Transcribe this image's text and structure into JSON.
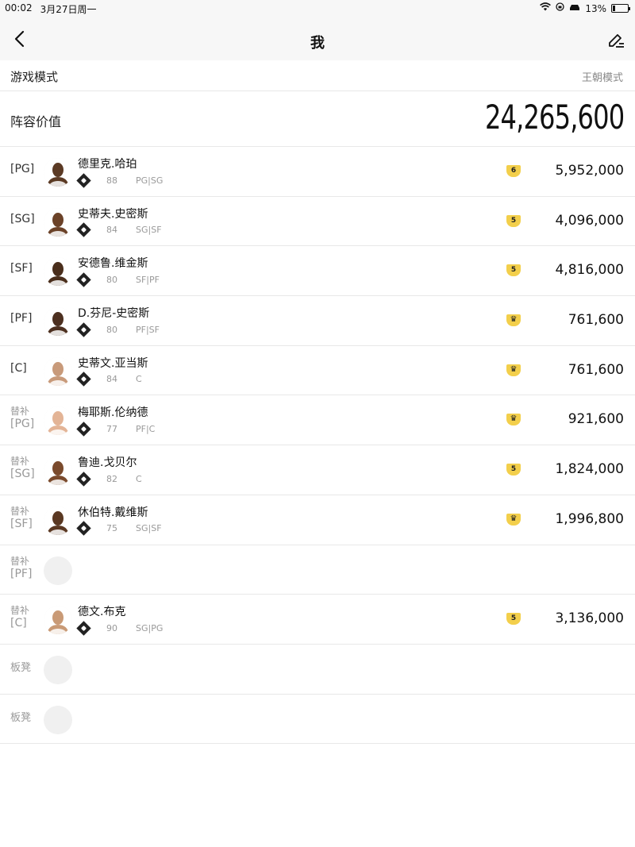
{
  "status_bar": {
    "time": "00:02",
    "date": "3月27日周一",
    "battery": "13%",
    "battery_level": 0.13
  },
  "nav": {
    "title": "我",
    "back_icon": "chevron-left-icon",
    "edit_icon": "edit-icon"
  },
  "game_mode": {
    "label": "游戏模式",
    "value": "王朝模式"
  },
  "lineup_value": {
    "label": "阵容价值",
    "value": "24,265,600"
  },
  "players": [
    {
      "slot": "[PG]",
      "sub_tag": "",
      "name": "德里克.哈珀",
      "ovr": "88",
      "positions": "PG|SG",
      "tier": "6",
      "tier_type": "number",
      "price": "5,952,000",
      "skin": "#5b3a24"
    },
    {
      "slot": "[SG]",
      "sub_tag": "",
      "name": "史蒂夫.史密斯",
      "ovr": "84",
      "positions": "SG|SF",
      "tier": "5",
      "tier_type": "number",
      "price": "4,096,000",
      "skin": "#6b4228"
    },
    {
      "slot": "[SF]",
      "sub_tag": "",
      "name": "安德鲁.维金斯",
      "ovr": "80",
      "positions": "SF|PF",
      "tier": "5",
      "tier_type": "number",
      "price": "4,816,000",
      "skin": "#4a2e1c"
    },
    {
      "slot": "[PF]",
      "sub_tag": "",
      "name": "D.芬尼-史密斯",
      "ovr": "80",
      "positions": "PF|SF",
      "tier": "♛",
      "tier_type": "crown",
      "price": "761,600",
      "skin": "#4d3020"
    },
    {
      "slot": "[C]",
      "sub_tag": "",
      "name": "史蒂文.亚当斯",
      "ovr": "84",
      "positions": "C",
      "tier": "♛",
      "tier_type": "crown",
      "price": "761,600",
      "skin": "#c89a7a"
    },
    {
      "slot": "[PG]",
      "sub_tag": "替补",
      "name": "梅耶斯.伦纳德",
      "ovr": "77",
      "positions": "PF|C",
      "tier": "♛",
      "tier_type": "crown",
      "price": "921,600",
      "skin": "#e3b496"
    },
    {
      "slot": "[SG]",
      "sub_tag": "替补",
      "name": "鲁迪.戈贝尔",
      "ovr": "82",
      "positions": "C",
      "tier": "5",
      "tier_type": "number",
      "price": "1,824,000",
      "skin": "#7a4a2c"
    },
    {
      "slot": "[SF]",
      "sub_tag": "替补",
      "name": "休伯特.戴维斯",
      "ovr": "75",
      "positions": "SG|SF",
      "tier": "♛",
      "tier_type": "crown",
      "price": "1,996,800",
      "skin": "#5a3822"
    },
    {
      "slot": "[PF]",
      "sub_tag": "替补",
      "name": "",
      "ovr": "",
      "positions": "",
      "tier": "",
      "tier_type": "empty",
      "price": "",
      "skin": ""
    },
    {
      "slot": "[C]",
      "sub_tag": "替补",
      "name": "德文.布克",
      "ovr": "90",
      "positions": "SG|PG",
      "tier": "5",
      "tier_type": "number",
      "price": "3,136,000",
      "skin": "#c99a76"
    },
    {
      "slot": "板凳",
      "sub_tag": "",
      "name": "",
      "ovr": "",
      "positions": "",
      "tier": "",
      "tier_type": "empty",
      "price": "",
      "skin": "",
      "bench": true
    },
    {
      "slot": "板凳",
      "sub_tag": "",
      "name": "",
      "ovr": "",
      "positions": "",
      "tier": "",
      "tier_type": "empty",
      "price": "",
      "skin": "",
      "bench": true
    }
  ]
}
